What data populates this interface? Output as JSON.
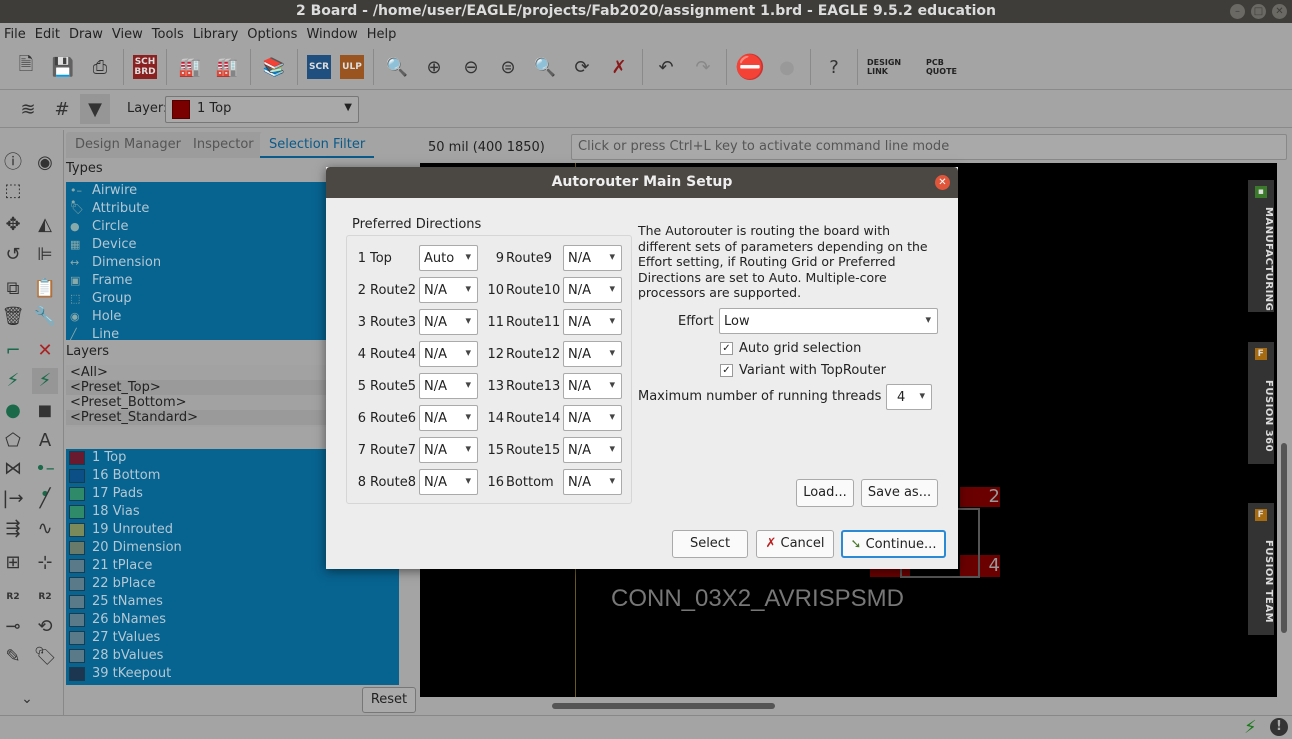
{
  "window": {
    "title": "2 Board - /home/user/EAGLE/projects/Fab2020/assignment 1.brd - EAGLE 9.5.2 education"
  },
  "menu": [
    "File",
    "Edit",
    "Draw",
    "View",
    "Tools",
    "Library",
    "Options",
    "Window",
    "Help"
  ],
  "toolbar": {
    "sch_brd": "SCH BRD",
    "scr": "SCR",
    "ulp": "ULP",
    "design_link": "DESIGN LINK",
    "pcb_quote": "PCB QUOTE",
    "layer_label": "Layer:",
    "layer_value": "1 Top",
    "layer_color": "#7a0000"
  },
  "panel": {
    "tabs": [
      "Design Manager",
      "Inspector",
      "Selection Filter"
    ],
    "active_tab": "Selection Filter",
    "types_label": "Types",
    "types": [
      "Airwire",
      "Attribute",
      "Circle",
      "Device",
      "Dimension",
      "Frame",
      "Group",
      "Hole",
      "Line"
    ],
    "layers_label": "Layers",
    "presets": [
      "<All>",
      "<Preset_Top>",
      "<Preset_Bottom>",
      "<Preset_Standard>"
    ],
    "layers": [
      {
        "name": "1 Top",
        "color": "#6a1a2e"
      },
      {
        "name": "16 Bottom",
        "color": "#0b4f86"
      },
      {
        "name": "17 Pads",
        "color": "#2f8a6a"
      },
      {
        "name": "18 Vias",
        "color": "#2f8a6a"
      },
      {
        "name": "19 Unrouted",
        "color": "#7a8a5a"
      },
      {
        "name": "20 Dimension",
        "color": "#6a7a6a"
      },
      {
        "name": "21 tPlace",
        "color": "#5a7a8a"
      },
      {
        "name": "22 bPlace",
        "color": "#5a7a8a"
      },
      {
        "name": "25 tNames",
        "color": "#5a7a8a"
      },
      {
        "name": "26 bNames",
        "color": "#5a7a8a"
      },
      {
        "name": "27 tValues",
        "color": "#5a7a8a"
      },
      {
        "name": "28 bValues",
        "color": "#5a7a8a"
      },
      {
        "name": "39 tKeepout",
        "color": "#1c3550"
      }
    ],
    "reset": "Reset"
  },
  "canvas": {
    "coord": "50 mil (400 1850)",
    "command_placeholder": "Click or press Ctrl+L key to activate command line mode",
    "part_label": "CONN_03X2_AVRISPSMD",
    "pad2": "2",
    "pad4": "4"
  },
  "side_tabs": [
    "MANUFACTURING",
    "FUSION 360",
    "FUSION TEAM"
  ],
  "dialog": {
    "title": "Autorouter Main Setup",
    "group_label": "Preferred Directions",
    "left": [
      {
        "n": "1",
        "name": "Top",
        "v": "Auto"
      },
      {
        "n": "2",
        "name": "Route2",
        "v": "N/A"
      },
      {
        "n": "3",
        "name": "Route3",
        "v": "N/A"
      },
      {
        "n": "4",
        "name": "Route4",
        "v": "N/A"
      },
      {
        "n": "5",
        "name": "Route5",
        "v": "N/A"
      },
      {
        "n": "6",
        "name": "Route6",
        "v": "N/A"
      },
      {
        "n": "7",
        "name": "Route7",
        "v": "N/A"
      },
      {
        "n": "8",
        "name": "Route8",
        "v": "N/A"
      }
    ],
    "right": [
      {
        "n": "9",
        "name": "Route9",
        "v": "N/A"
      },
      {
        "n": "10",
        "name": "Route10",
        "v": "N/A"
      },
      {
        "n": "11",
        "name": "Route11",
        "v": "N/A"
      },
      {
        "n": "12",
        "name": "Route12",
        "v": "N/A"
      },
      {
        "n": "13",
        "name": "Route13",
        "v": "N/A"
      },
      {
        "n": "14",
        "name": "Route14",
        "v": "N/A"
      },
      {
        "n": "15",
        "name": "Route15",
        "v": "N/A"
      },
      {
        "n": "16",
        "name": "Bottom",
        "v": "N/A"
      }
    ],
    "description": "The Autorouter is routing the board with different sets of parameters depending on the Effort setting, if Routing Grid or Preferred Directions are set to Auto. Multiple-core processors are supported.",
    "effort_label": "Effort",
    "effort_value": "Low",
    "auto_grid": "Auto grid selection",
    "auto_grid_checked": true,
    "variant": "Variant with TopRouter",
    "variant_checked": true,
    "threads_label": "Maximum number of running threads",
    "threads_value": "4",
    "load": "Load...",
    "save_as": "Save as...",
    "select": "Select",
    "cancel": "Cancel",
    "continue": "Continue..."
  }
}
